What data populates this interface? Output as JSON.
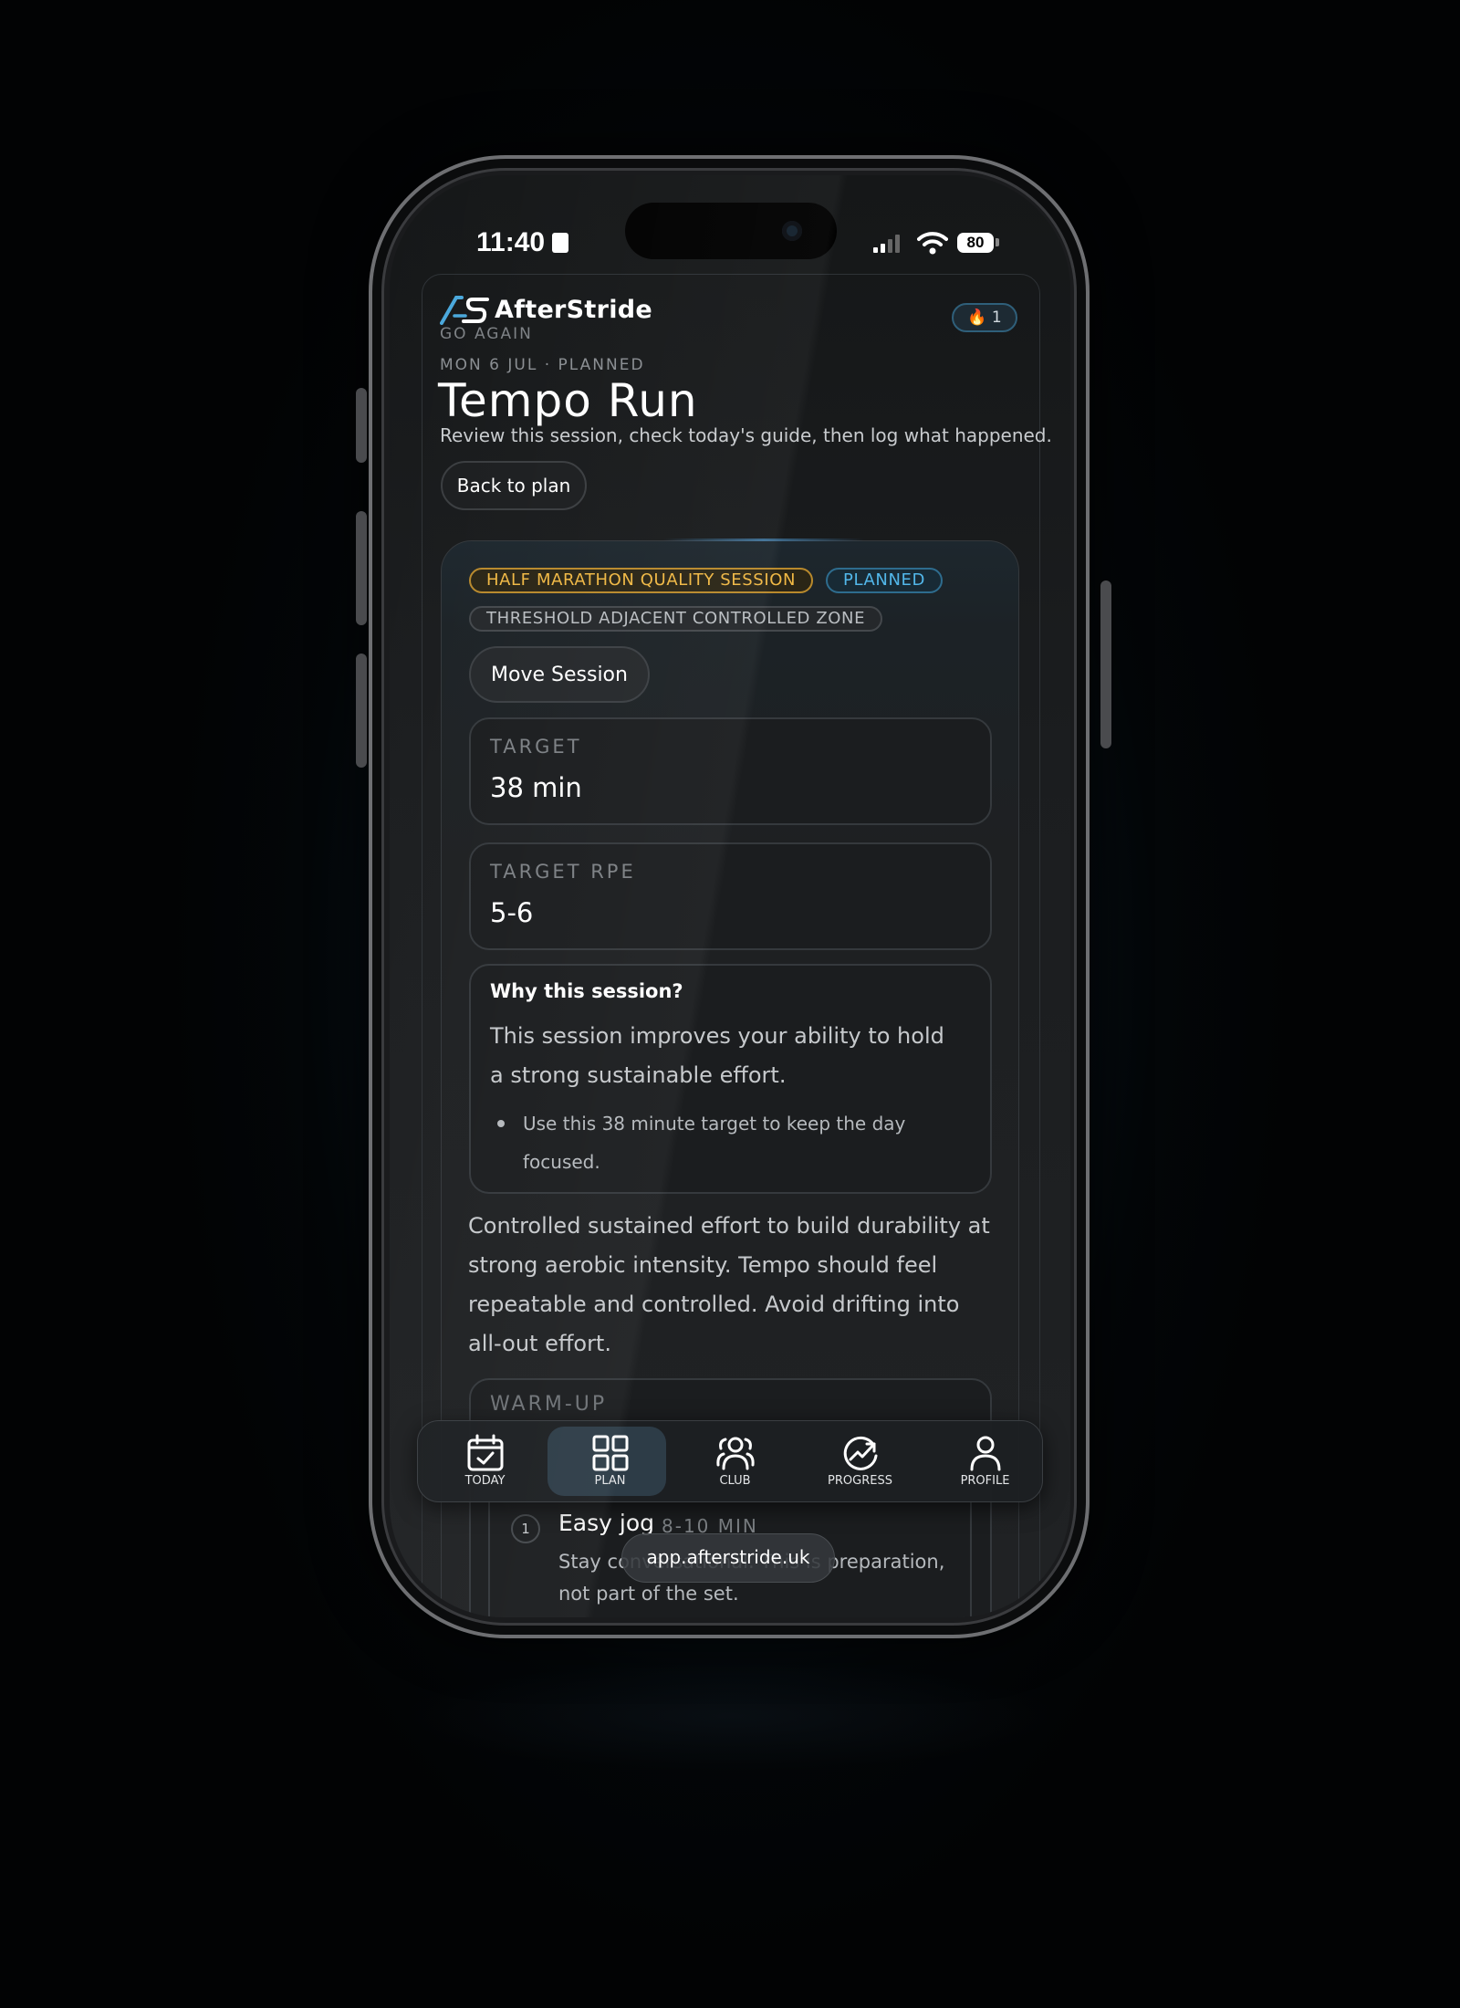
{
  "status_bar": {
    "time": "11:40",
    "battery": "80"
  },
  "app": {
    "brand": "AfterStride",
    "tagline": "GO AGAIN",
    "streak_count": "1",
    "accent_color": "#4aa8dc"
  },
  "header": {
    "date_line": "MON 6 JUL · PLANNED",
    "title": "Tempo Run",
    "subtitle": "Review this session, check today's guide, then log what happened.",
    "back_button": "Back to plan"
  },
  "session": {
    "chips": {
      "type": "HALF MARATHON QUALITY SESSION",
      "status": "PLANNED",
      "zone": "THRESHOLD ADJACENT CONTROLLED ZONE"
    },
    "move_button": "Move Session",
    "target": {
      "label": "TARGET",
      "value": "38 min"
    },
    "target_rpe": {
      "label": "TARGET RPE",
      "value": "5-6"
    },
    "why": {
      "title": "Why this session?",
      "body": "This session improves your ability to hold a strong sustainable effort.",
      "bullet": "Use this 38 minute target to keep the day focused."
    },
    "description": "Controlled sustained effort to build durability at strong aerobic intensity. Tempo should feel repeatable and controlled. Avoid drifting into all-out effort.",
    "warmup": {
      "label": "WARM-UP",
      "steps": [
        {
          "number": "1",
          "title": "Easy jog",
          "duration": "8-10 MIN",
          "description": "Stay conversational. This is preparation, not part of the set."
        }
      ]
    }
  },
  "bottom_nav": {
    "items": [
      {
        "label": "TODAY",
        "icon": "calendar-check-icon"
      },
      {
        "label": "PLAN",
        "icon": "grid-icon",
        "active": true
      },
      {
        "label": "CLUB",
        "icon": "group-icon"
      },
      {
        "label": "PROGRESS",
        "icon": "trend-up-icon"
      },
      {
        "label": "PROFILE",
        "icon": "user-icon"
      }
    ]
  },
  "browser": {
    "url": "app.afterstride.uk"
  }
}
